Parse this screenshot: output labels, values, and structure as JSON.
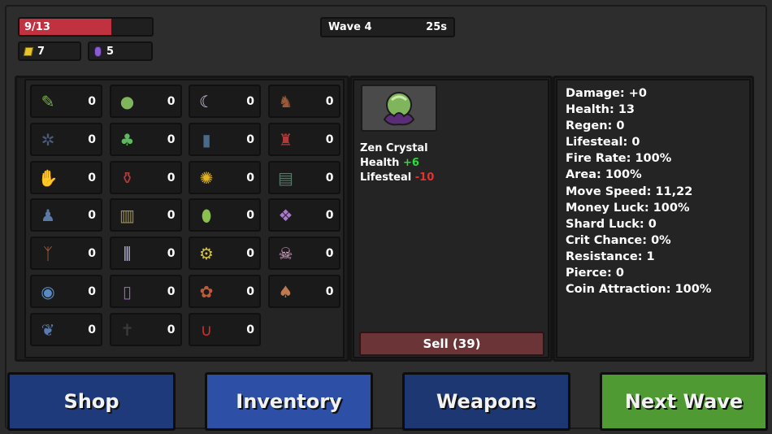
{
  "status": {
    "health_text": "9/13",
    "health_fraction": 0.6923,
    "gold": "7",
    "shards": "5",
    "wave_label": "Wave 4",
    "wave_timer": "25s"
  },
  "colors": {
    "health": "#c0323f",
    "shop": "#1f3a7a",
    "inventory": "#2d4fa5",
    "weapons": "#1d3772",
    "next_wave": "#4f9a32",
    "stat_positive": "#2ddc3a",
    "stat_negative": "#e8302f"
  },
  "inventory": [
    {
      "icon": "syringe-icon",
      "count": "0"
    },
    {
      "icon": "zen-crystal-icon",
      "count": "0"
    },
    {
      "icon": "claw-icon",
      "count": "0"
    },
    {
      "icon": "boot-icon",
      "count": "0"
    },
    {
      "icon": "web-icon",
      "count": "0"
    },
    {
      "icon": "clover-icon",
      "count": "0"
    },
    {
      "icon": "sock-icon",
      "count": "0"
    },
    {
      "icon": "armor-icon",
      "count": "0"
    },
    {
      "icon": "skeleton-hand-icon",
      "count": "0"
    },
    {
      "icon": "potion-icon",
      "count": "0"
    },
    {
      "icon": "gold-orb-icon",
      "count": "0"
    },
    {
      "icon": "treasure-chest-icon",
      "count": "0"
    },
    {
      "icon": "blue-figure-icon",
      "count": "0"
    },
    {
      "icon": "scroll-icon",
      "count": "0"
    },
    {
      "icon": "green-gem-icon",
      "count": "0"
    },
    {
      "icon": "purple-orbs-icon",
      "count": "0"
    },
    {
      "icon": "root-icon",
      "count": "0"
    },
    {
      "icon": "crystals-icon",
      "count": "0"
    },
    {
      "icon": "golden-gear-icon",
      "count": "0"
    },
    {
      "icon": "pink-skull-icon",
      "count": "0"
    },
    {
      "icon": "blue-eye-icon",
      "count": "0"
    },
    {
      "icon": "vial-icon",
      "count": "0"
    },
    {
      "icon": "red-seed-icon",
      "count": "0"
    },
    {
      "icon": "mushroom-icon",
      "count": "0"
    },
    {
      "icon": "wings-icon",
      "count": "0"
    },
    {
      "icon": "dark-cross-icon",
      "count": "0"
    },
    {
      "icon": "magnet-icon",
      "count": "0"
    }
  ],
  "selected_item": {
    "name": "Zen Crystal",
    "icon": "zen-crystal-icon",
    "health_label": "Health",
    "health_value": "+6",
    "lifesteal_label": "Lifesteal",
    "lifesteal_value": "-10",
    "sell_label": "Sell (39)"
  },
  "stats": [
    "Damage: +0",
    "Health: 13",
    "Regen: 0",
    "Lifesteal: 0",
    "Fire Rate: 100%",
    "Area: 100%",
    "Move Speed: 11,22",
    "Money Luck: 100%",
    "Shard Luck: 0",
    "Crit Chance: 0%",
    "Resistance: 1",
    "Pierce: 0",
    "Coin Attraction: 100%"
  ],
  "nav": {
    "shop": "Shop",
    "inventory": "Inventory",
    "weapons": "Weapons",
    "next_wave": "Next Wave"
  }
}
